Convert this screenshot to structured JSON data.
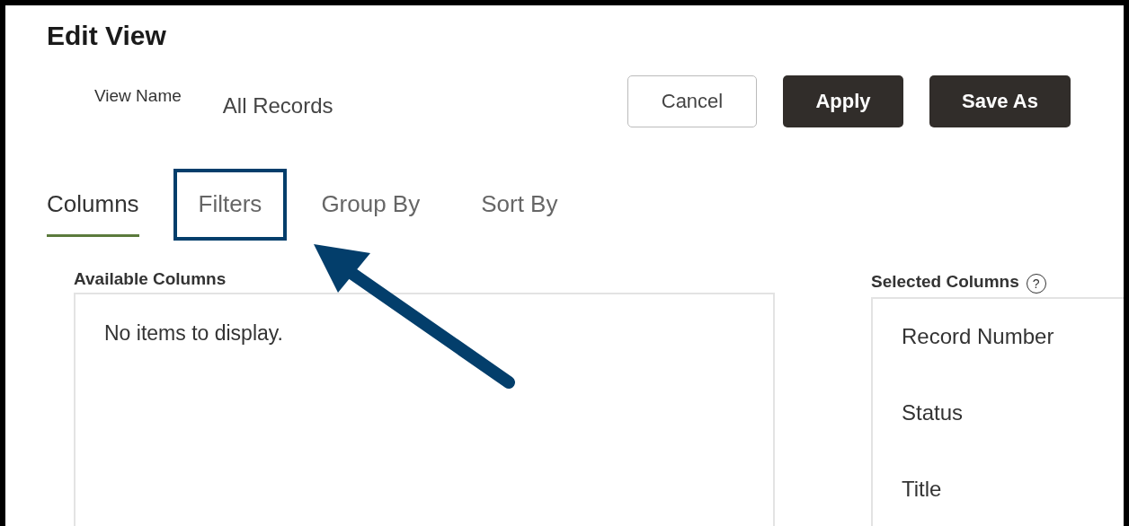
{
  "title": "Edit View",
  "view_name": {
    "label": "View Name",
    "value": "All Records"
  },
  "buttons": [
    {
      "label": "Cancel",
      "kind": "secondary"
    },
    {
      "label": "Apply",
      "kind": "primary"
    },
    {
      "label": "Save As",
      "kind": "primary"
    }
  ],
  "tabs": [
    {
      "label": "Columns",
      "selected": true,
      "highlighted": false
    },
    {
      "label": "Filters",
      "selected": false,
      "highlighted": true
    },
    {
      "label": "Group By",
      "selected": false,
      "highlighted": false
    },
    {
      "label": "Sort By",
      "selected": false,
      "highlighted": false
    }
  ],
  "available_columns": {
    "label": "Available Columns",
    "empty_text": "No items to display."
  },
  "selected_columns": {
    "label": "Selected Columns",
    "help_icon": "?",
    "items": [
      "Record Number",
      "Status",
      "Title"
    ]
  }
}
